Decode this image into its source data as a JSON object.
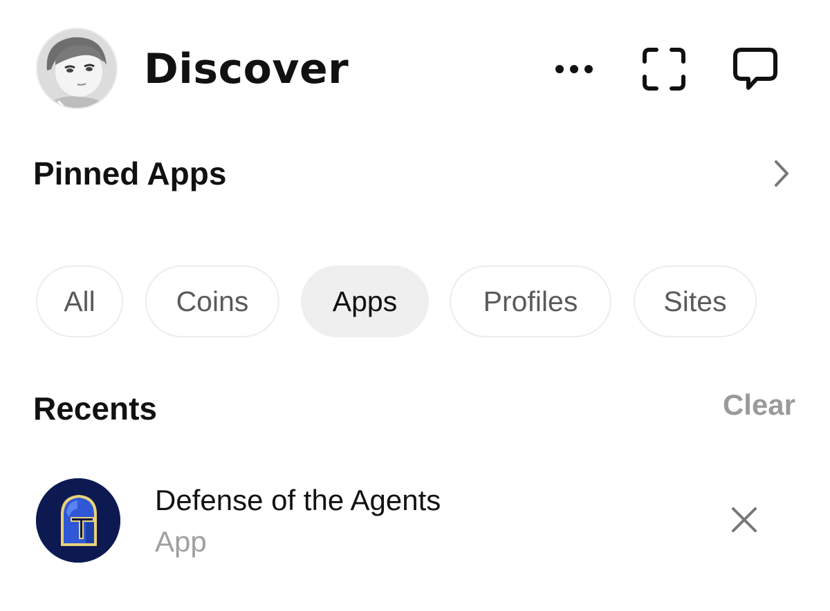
{
  "header": {
    "title": "Discover",
    "avatar_icon": "user-avatar",
    "more_icon": "more-horizontal-icon",
    "scan_icon": "scan-icon",
    "chat_icon": "chat-bubble-icon"
  },
  "pinned": {
    "title": "Pinned Apps",
    "chevron_icon": "chevron-right-icon"
  },
  "filters": {
    "selected": "Apps",
    "items": [
      {
        "label": "All"
      },
      {
        "label": "Coins"
      },
      {
        "label": "Apps"
      },
      {
        "label": "Profiles"
      },
      {
        "label": "Sites"
      }
    ]
  },
  "recents": {
    "title": "Recents",
    "clear_label": "Clear",
    "items": [
      {
        "name": "Defense of the Agents",
        "type": "App",
        "icon": "knight-helmet-icon",
        "remove_icon": "close-icon"
      }
    ]
  },
  "colors": {
    "text_primary": "#111111",
    "text_secondary": "#a0a0a0",
    "chip_active_bg": "#efefef",
    "chip_border": "#ececec",
    "app_icon_bg": "#0d1a52",
    "app_icon_helmet": "#2f57d6"
  }
}
